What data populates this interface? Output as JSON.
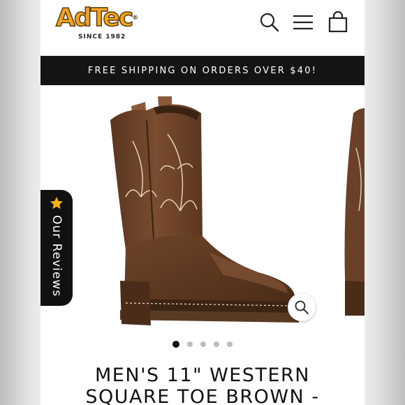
{
  "header": {
    "logo_text": "AdTec",
    "logo_tagline": "since 1982",
    "search_icon": "search-icon",
    "menu_icon": "hamburger-menu-icon",
    "cart_icon": "shopping-bag-icon"
  },
  "banner": {
    "text": "FREE SHIPPING ON ORDERS OVER $40!"
  },
  "gallery": {
    "reviews_tab_label": "Our Reviews",
    "reviews_icon": "star-icon",
    "zoom_icon": "magnifier-zoom-icon",
    "slide_count": 5,
    "active_slide": 1
  },
  "product": {
    "title_line1": "MEN'S 11\" WESTERN",
    "title_line2": "SQUARE TOE BROWN -"
  },
  "colors": {
    "logo_orange": "#f2a41c",
    "banner_bg": "#141414",
    "boot_brown": "#6b4226"
  }
}
